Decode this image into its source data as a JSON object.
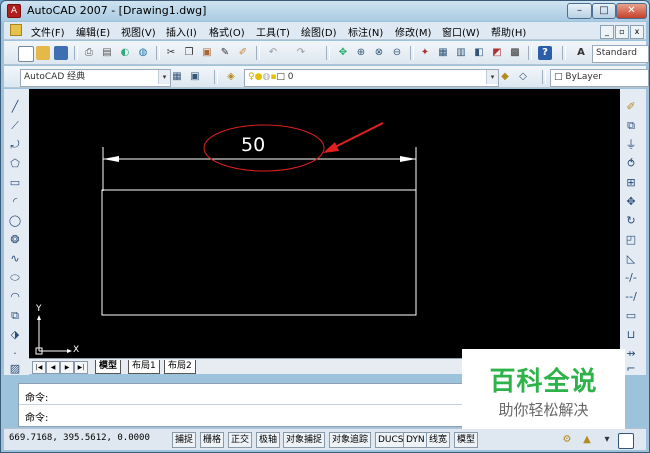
{
  "window": {
    "title": "AutoCAD 2007 - [Drawing1.dwg]",
    "app_icon": "autocad-icon",
    "controls": {
      "minimize": "–",
      "maximize": "□",
      "close": "✕"
    }
  },
  "menu": {
    "items": [
      "文件(F)",
      "编辑(E)",
      "视图(V)",
      "插入(I)",
      "格式(O)",
      "工具(T)",
      "绘图(D)",
      "标注(N)",
      "修改(M)",
      "窗口(W)",
      "帮助(H)"
    ],
    "mdi_controls": {
      "minimize": "_",
      "restore": "▫",
      "close": "x"
    }
  },
  "toolbar": {
    "text_style": "Standard",
    "workspace": "AutoCAD 经典",
    "layer": "0",
    "linetype": "ByLayer",
    "dropdown_arrow": "▾"
  },
  "drawing": {
    "dimension_text": "50",
    "ucs_y": "Y",
    "ucs_x": "X",
    "colors": {
      "background": "#000000",
      "geometry": "#ffffff",
      "annotation": "#e02020"
    }
  },
  "tabs": {
    "nav": [
      "|◀",
      "◀",
      "▶",
      "▶|"
    ],
    "items": [
      "模型",
      "布局1",
      "布局2"
    ]
  },
  "command": {
    "line1": "命令:",
    "line2": "命令:"
  },
  "status": {
    "coords": "669.7168, 395.5612, 0.0000",
    "toggles": [
      "捕捉",
      "栅格",
      "正交",
      "极轴",
      "对象捕捉",
      "对象追踪",
      "DUCS",
      "DYN",
      "线宽",
      "模型"
    ]
  },
  "watermark": {
    "title": "百科全说",
    "subtitle": "助你轻松解决"
  }
}
